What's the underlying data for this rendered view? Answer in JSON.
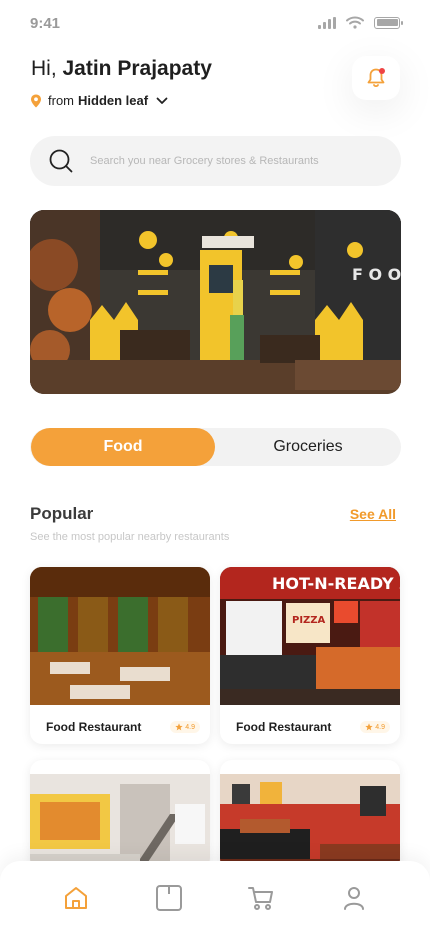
{
  "status": {
    "time": "9:41"
  },
  "header": {
    "greeting_prefix": "Hi, ",
    "user_name": "Jatin Prajapaty",
    "location_prefix": "from",
    "location_name": "Hidden leaf"
  },
  "search": {
    "placeholder": "Search you near Grocery stores & Restaurants"
  },
  "tabs": [
    {
      "label": "Food",
      "active": true
    },
    {
      "label": "Groceries",
      "active": false
    }
  ],
  "popular": {
    "title": "Popular",
    "see_all": "See All",
    "subtitle": "See the most popular nearby restaurants",
    "items": [
      {
        "name": "Food Restaurant",
        "rating": "4.9"
      },
      {
        "name": "Food Restaurant",
        "rating": "4.9"
      }
    ]
  },
  "nav": [
    "home-icon",
    "orders-icon",
    "cart-icon",
    "profile-icon"
  ],
  "colors": {
    "accent": "#F4A13A",
    "text": "#1F1F1F",
    "muted": "#B7B7B7"
  }
}
